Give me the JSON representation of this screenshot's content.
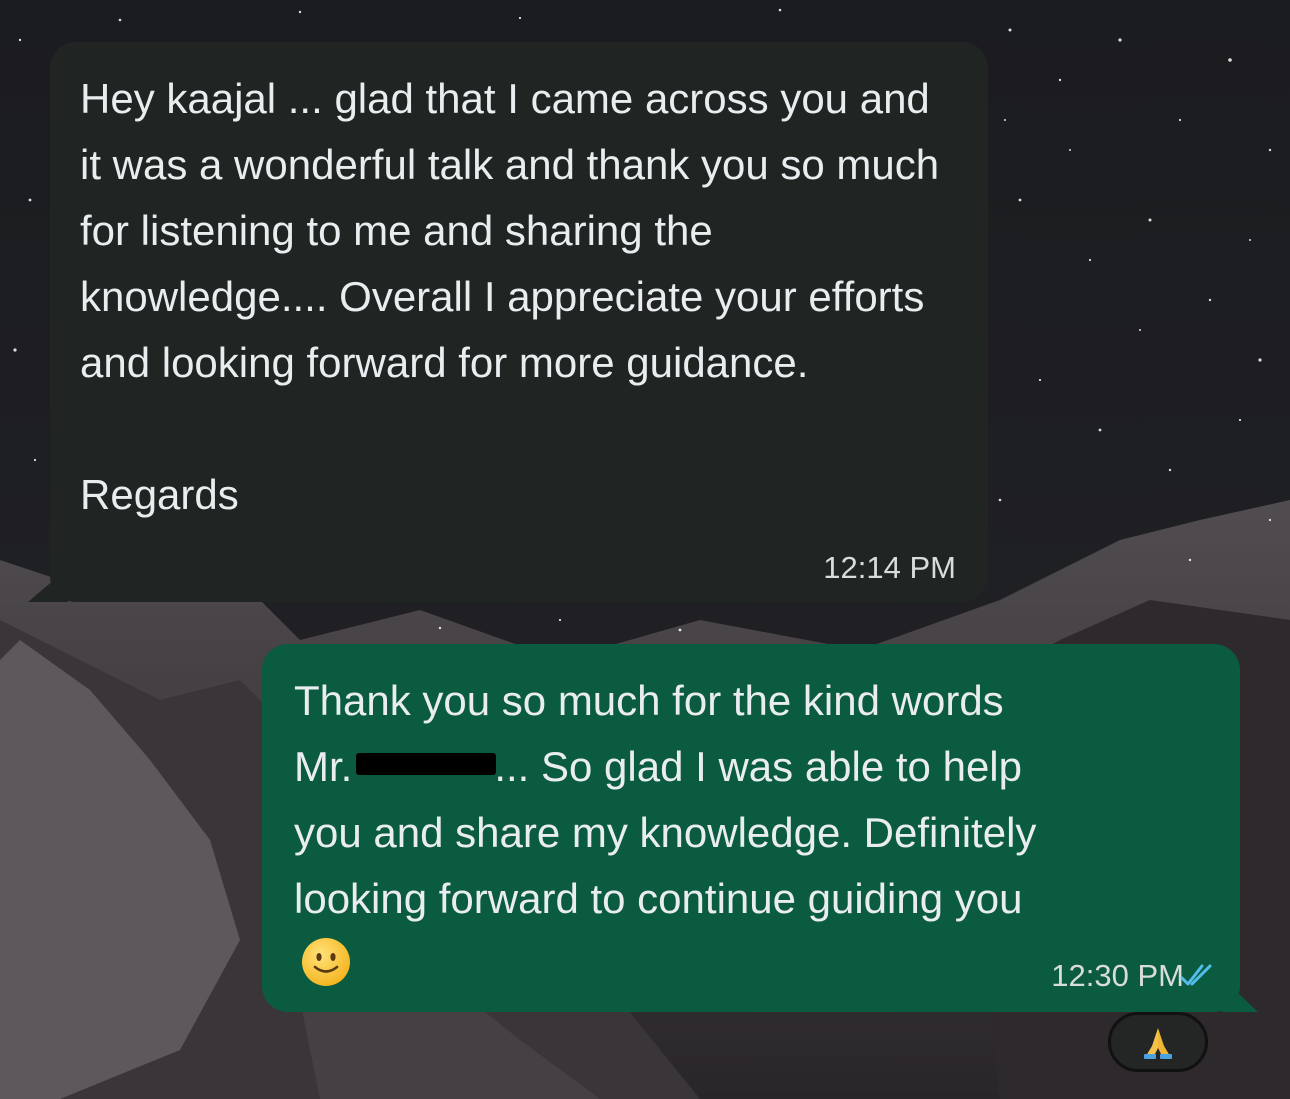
{
  "messages": {
    "incoming": {
      "text": "Hey kaajal ... glad that I came across you and it was a wonderful talk and thank you so much for listening to me and sharing the knowledge.... Overall I appreciate your efforts and looking forward for more guidance.",
      "signoff": "Regards",
      "time": "12:14 PM"
    },
    "outgoing": {
      "line1": "Thank you so much for the kind words",
      "line2_prefix": "Mr.",
      "line2_suffix": "... So glad I was able to help",
      "line3": "you and share my knowledge. Definitely",
      "line4": "looking forward to continue guiding you",
      "emoji": "slightly-smiling-face-icon",
      "time": "12:30 PM",
      "status": "read"
    },
    "reaction": {
      "emoji": "folded-hands-icon"
    }
  },
  "colors": {
    "incoming_bubble": "#202422",
    "outgoing_bubble": "#0b5b40",
    "read_receipt": "#53bdeb",
    "text": "#e9edef"
  }
}
